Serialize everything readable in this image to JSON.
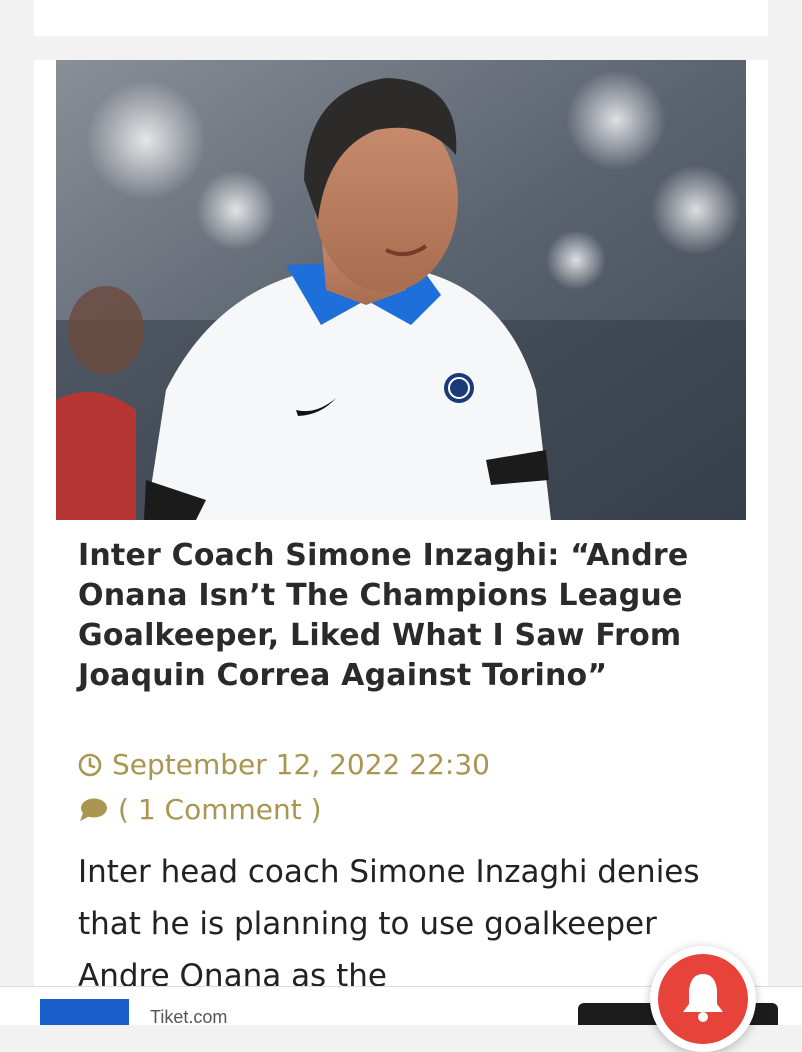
{
  "article": {
    "title": "Inter Coach Simone Inzaghi: “Andre Onana Isn’t The Champions League Goalkeeper, Liked What I Saw From Joaquin Correa Against Torino”",
    "date": "September 12, 2022 22:30",
    "comments": "( 1 Comment )",
    "excerpt": "Inter head coach Simone Inzaghi denies that he is planning to use goalkeeper Andre Onana as the",
    "image": "photo of smiling coach in white polo shirt with blue collar"
  },
  "ad": {
    "brand": "Tiket.com"
  },
  "icons": {
    "date": "clock-icon",
    "comments": "speech-bubble-icon",
    "notification": "bell-icon"
  },
  "colors": {
    "meta": "#a99650",
    "headline": "#2a2a2a",
    "notification": "#e8433a",
    "ad_logo": "#1a5ecc"
  }
}
